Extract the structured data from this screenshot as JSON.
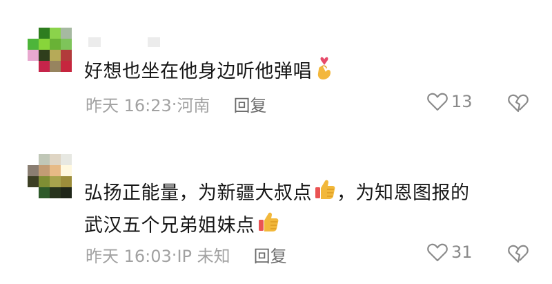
{
  "comments": [
    {
      "text": "好想也坐在他身边听他弹唱",
      "emoji": "finger-heart-icon",
      "timestamp": "昨天 16:23",
      "location": "河南",
      "reply_label": "回复",
      "like_count": "13"
    },
    {
      "line1": "弘扬正能量，为新疆大叔点",
      "line1_tail": "，为知恩图报的",
      "line2": "武汉五个兄弟姐妹点",
      "emoji": "thumbs-up-icon",
      "timestamp": "昨天 16:03",
      "location": "IP 未知",
      "reply_label": "回复",
      "like_count": "31"
    }
  ],
  "colors": {
    "text": "#161616",
    "meta": "#a2a2a2",
    "reply": "#6b6b6b",
    "thumb": "#f2b83b"
  }
}
